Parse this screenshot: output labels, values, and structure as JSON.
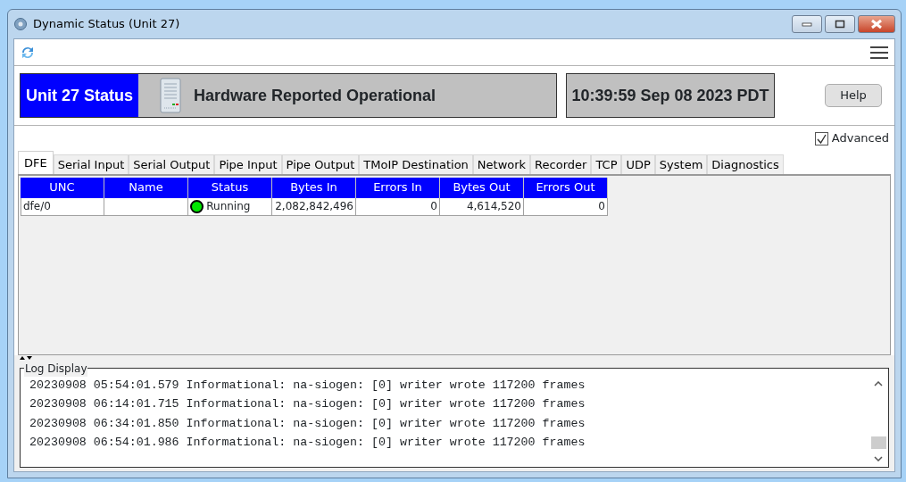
{
  "window": {
    "title": "Dynamic Status (Unit 27)"
  },
  "header": {
    "unit_label": "Unit 27 Status",
    "status_text": "Hardware Reported Operational",
    "clock": "10:39:59 Sep 08 2023 PDT",
    "help_button": "Help"
  },
  "advanced": {
    "label": "Advanced",
    "checked": true
  },
  "tabs": [
    {
      "label": "DFE",
      "selected": true
    },
    {
      "label": "Serial Input",
      "selected": false
    },
    {
      "label": "Serial Output",
      "selected": false
    },
    {
      "label": "Pipe Input",
      "selected": false
    },
    {
      "label": "Pipe Output",
      "selected": false
    },
    {
      "label": "TMoIP Destination",
      "selected": false
    },
    {
      "label": "Network",
      "selected": false
    },
    {
      "label": "Recorder",
      "selected": false
    },
    {
      "label": "TCP",
      "selected": false
    },
    {
      "label": "UDP",
      "selected": false
    },
    {
      "label": "System",
      "selected": false
    },
    {
      "label": "Diagnostics",
      "selected": false
    }
  ],
  "table": {
    "columns": [
      "UNC",
      "Name",
      "Status",
      "Bytes In",
      "Errors In",
      "Bytes Out",
      "Errors Out"
    ],
    "rows": [
      {
        "unc": "dfe/0",
        "name": "",
        "status": "Running",
        "color": "#00e600",
        "bytes_in": "2,082,842,496",
        "errors_in": "0",
        "bytes_out": "4,614,520",
        "errors_out": "0"
      }
    ]
  },
  "log": {
    "title": "Log Display",
    "lines": [
      "20230908 05:54:01.579 Informational: na-siogen: [0] writer wrote 117200 frames",
      "20230908 06:14:01.715 Informational: na-siogen: [0] writer wrote 117200 frames",
      "20230908 06:34:01.850 Informational: na-siogen: [0] writer wrote 117200 frames",
      "20230908 06:54:01.986 Informational: na-siogen: [0] writer wrote 117200 frames"
    ]
  }
}
